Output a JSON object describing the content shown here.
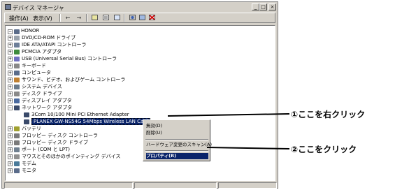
{
  "window": {
    "title": "デバイス マネージャ",
    "min": "_",
    "max": "□",
    "close": "×"
  },
  "menu": {
    "action": "操作(A)",
    "view": "表示(V)"
  },
  "toolbar": {
    "back": "←",
    "forward": "→"
  },
  "tree": {
    "root": "HONOR",
    "items": [
      "DVD/CD-ROM ドライブ",
      "IDE ATA/ATAPI コントローラ",
      "PCMCIA アダプタ",
      "USB (Universal Serial Bus) コントローラ",
      "キーボード",
      "コンピュータ",
      "サウンド、ビデオ、およびゲーム コントローラ",
      "システム デバイス",
      "ディスク ドライブ",
      "ディスプレイ アダプタ",
      "ネットワーク アダプタ",
      "3Com 10/100 Mini PCI Ethernet Adapter",
      "PLANEX GW-NS54G 54Mbps Wireless LAN Card",
      "バッテリ",
      "フロッピー ディスク コントローラ",
      "フロッピー ディスク ドライブ",
      "ポート (COM と LPT)",
      "マウスとそのほかのポインティング デバイス",
      "モデム",
      "モニタ"
    ]
  },
  "context_menu": {
    "items": [
      "無効(D)",
      "削除(U)",
      "ハードウェア変更のスキャン(A)",
      "プロパティ(R)"
    ]
  },
  "callouts": {
    "first": "①ここを右クリック",
    "second": "②ここをクリック"
  }
}
